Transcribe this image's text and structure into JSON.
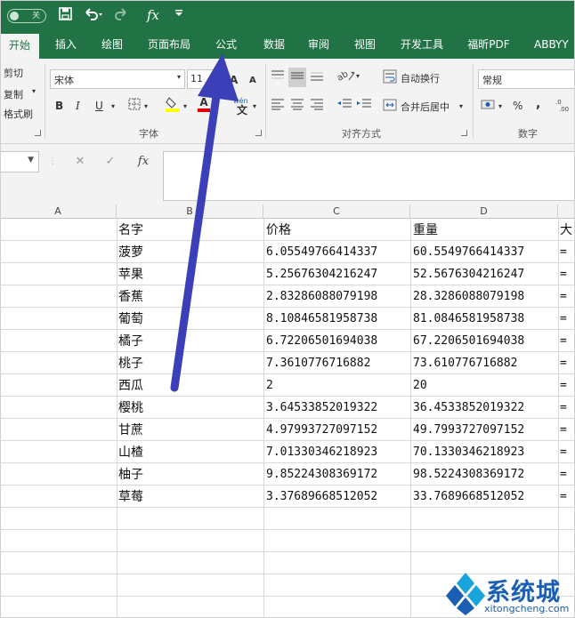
{
  "colors": {
    "accent": "#217346",
    "arrow": "#3b3fb8",
    "logo_blue": "#1a5fb4",
    "logo_cyan": "#1aa4dc"
  },
  "qat": {
    "autosave_state": "关",
    "icons": [
      "save-icon",
      "undo-icon",
      "redo-icon",
      "fx-icon",
      "customize-icon"
    ],
    "fx_label": "fx"
  },
  "tabs": [
    "开始",
    "插入",
    "绘图",
    "页面布局",
    "公式",
    "数据",
    "审阅",
    "视图",
    "开发工具",
    "福昕PDF",
    "ABBYY"
  ],
  "ribbon": {
    "clipboard": {
      "cut": "剪切",
      "copy": "复制",
      "format_painter": "格式刷"
    },
    "font": {
      "name": "宋体",
      "size": "11",
      "grow": "A",
      "shrink": "A",
      "bold": "B",
      "italic": "I",
      "underline": "U",
      "font_color": "A",
      "phonetic": "wén",
      "group_label": "字体"
    },
    "alignment": {
      "wrap_text": "自动换行",
      "merge_center": "合并后居中",
      "group_label": "对齐方式"
    },
    "number": {
      "format": "常规",
      "percent": "%",
      "comma": ",",
      "group_label": "数字"
    }
  },
  "formula_bar": {
    "cancel": "✕",
    "enter": "✓",
    "fx": "fx",
    "content": ""
  },
  "columns": [
    "A",
    "B",
    "C",
    "D"
  ],
  "headers": {
    "name": "名字",
    "price": "价格",
    "weight": "重量",
    "e": "大"
  },
  "rows": [
    {
      "name": "菠萝",
      "price": "6.05549766414337",
      "weight": "60.5549766414337",
      "e": "="
    },
    {
      "name": "苹果",
      "price": "5.25676304216247",
      "weight": "52.5676304216247",
      "e": "="
    },
    {
      "name": "香蕉",
      "price": "2.83286088079198",
      "weight": "28.3286088079198",
      "e": "="
    },
    {
      "name": "葡萄",
      "price": "8.10846581958738",
      "weight": "81.0846581958738",
      "e": "="
    },
    {
      "name": "橘子",
      "price": "6.72206501694038",
      "weight": "67.2206501694038",
      "e": "="
    },
    {
      "name": "桃子",
      "price": "7.3610776716882",
      "weight": "73.610776716882",
      "e": "="
    },
    {
      "name": "西瓜",
      "price": "2",
      "weight": "20",
      "e": "="
    },
    {
      "name": "樱桃",
      "price": "3.64533852019322",
      "weight": "36.4533852019322",
      "e": "="
    },
    {
      "name": "甘蔗",
      "price": "4.97993727097152",
      "weight": "49.7993727097152",
      "e": "="
    },
    {
      "name": "山楂",
      "price": "7.01330346218923",
      "weight": "70.1330346218923",
      "e": "="
    },
    {
      "name": "柚子",
      "price": "9.85224308369172",
      "weight": "98.5224308369172",
      "e": "="
    },
    {
      "name": "草莓",
      "price": "3.37689668512052",
      "weight": "33.7689668512052",
      "e": "="
    }
  ],
  "watermark": {
    "title": "系统城",
    "url": "xitongcheng.com"
  }
}
